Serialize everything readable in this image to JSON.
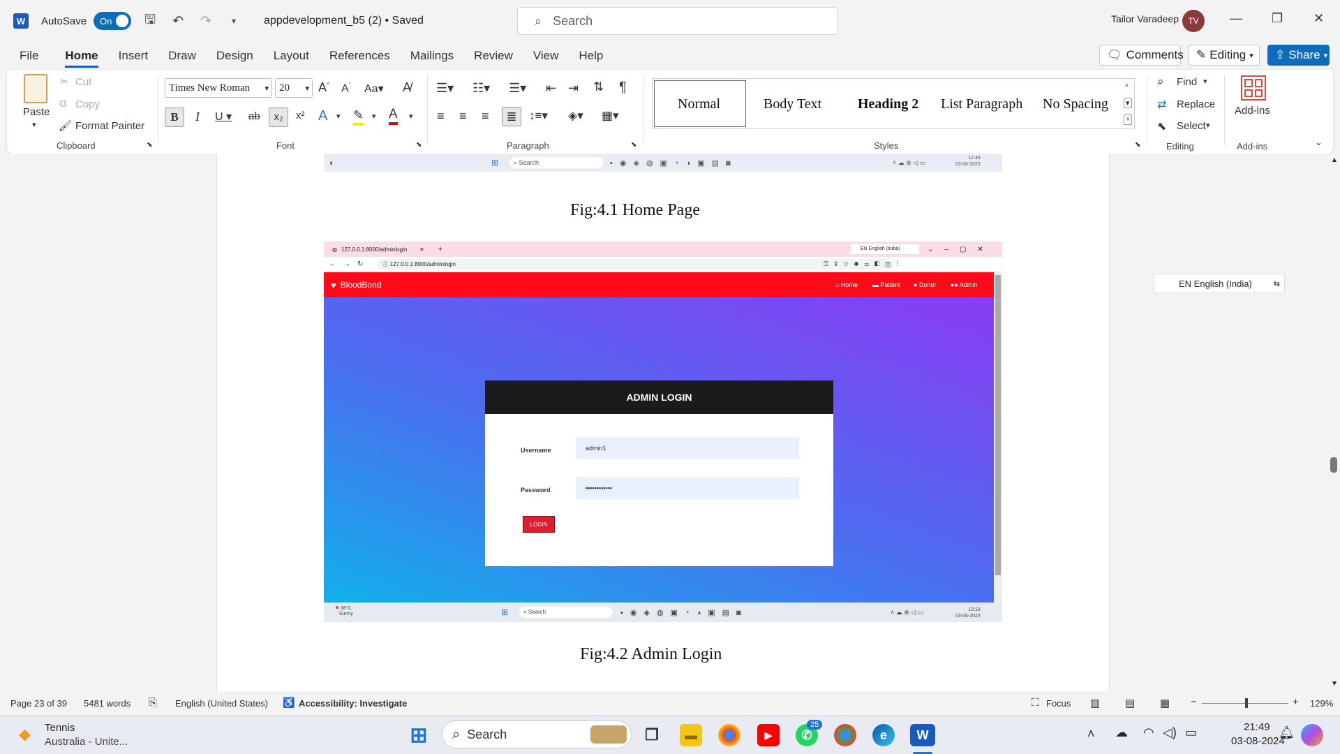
{
  "titlebar": {
    "autosave_label": "AutoSave",
    "autosave_state": "On",
    "doc_title": "appdevelopment_b5 (2) • Saved",
    "search_placeholder": "Search",
    "user_name": "Tailor Varadeep",
    "user_initials": "TV"
  },
  "menu": [
    "File",
    "Home",
    "Insert",
    "Draw",
    "Design",
    "Layout",
    "References",
    "Mailings",
    "Review",
    "View",
    "Help"
  ],
  "top_buttons": {
    "comments": "Comments",
    "editing": "Editing",
    "share": "Share"
  },
  "ribbon": {
    "clipboard": {
      "paste": "Paste",
      "cut": "Cut",
      "copy": "Copy",
      "format_painter": "Format Painter",
      "label": "Clipboard"
    },
    "font": {
      "family": "Times New Roman",
      "size": "20",
      "label": "Font"
    },
    "paragraph": {
      "label": "Paragraph"
    },
    "styles": {
      "items": [
        "Normal",
        "Body Text",
        "Heading 2",
        "List Paragraph",
        "No Spacing"
      ],
      "label": "Styles"
    },
    "editing": {
      "find": "Find",
      "replace": "Replace",
      "select": "Select",
      "label": "Editing"
    },
    "addins": {
      "button": "Add-ins",
      "label": "Add-ins"
    }
  },
  "document": {
    "caption1": "Fig:4.1 Home Page",
    "caption2": "Fig:4.2 Admin Login",
    "top_strip": {
      "search": "Search",
      "time": "12:48",
      "date": "03-06-2023"
    },
    "screenshot": {
      "tab_url": "127.0.0.1:8000/adminlogin",
      "address": "127.0.0.1:8000/adminlogin",
      "lang": "EN English (India)",
      "brand": "BloodBond",
      "nav": [
        "Home",
        "Patient",
        "Donor",
        "Admin"
      ],
      "card_title": "ADMIN LOGIN",
      "username_label": "Username",
      "username_value": "admin1",
      "password_label": "Password",
      "password_value": "••••••••••••",
      "login_button": "LOGIN",
      "weather_temp": "38°C",
      "weather_desc": "Sunny",
      "taskbar_search": "Search",
      "time": "13:15",
      "date": "03-06-2023"
    },
    "lang_overlay": "EN English (India)"
  },
  "status": {
    "page": "Page 23 of 39",
    "words": "5481 words",
    "language": "English (United States)",
    "accessibility": "Accessibility: Investigate",
    "focus": "Focus",
    "zoom": "129%"
  },
  "taskbar": {
    "weather_title": "Tennis",
    "weather_sub": "Australia - Unite...",
    "search": "Search",
    "whatsapp_badge": "25",
    "time": "21:49",
    "date": "03-08-2024"
  }
}
